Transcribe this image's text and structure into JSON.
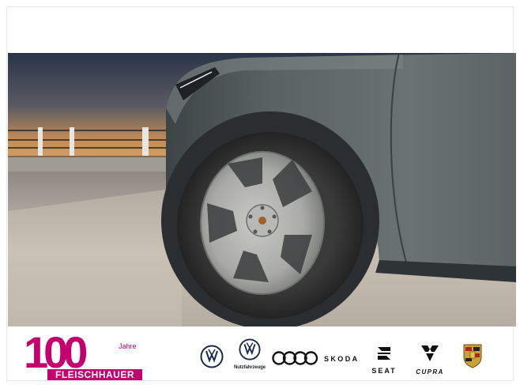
{
  "image": {
    "alt": "Vehicle wheel close-up"
  },
  "dealer": {
    "anniversary_number": "100",
    "anniversary_word": "Jahre",
    "name": "FLEISCHHAUER",
    "color": "#c4006e"
  },
  "brands": {
    "vw_nutzfahrzeuge_label": "Nutzfahrzeuge",
    "skoda": "SKODA",
    "seat": "SEAT",
    "cupra": "CUPRA"
  }
}
